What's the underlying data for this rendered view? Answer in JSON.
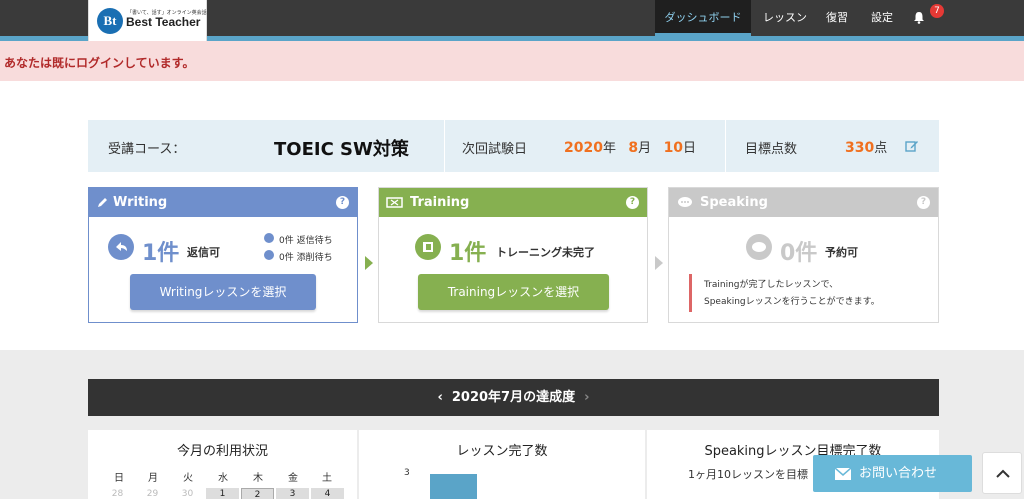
{
  "header": {
    "logo_tagline": "「書いて、話す」オンライン英会話",
    "logo_name": "Best Teacher",
    "logo_mark": "Bt",
    "nav": [
      "ダッシュボード",
      "レッスン",
      "復習",
      "設定"
    ],
    "notification_count": "7"
  },
  "alert": "あなたは既にログインしています。",
  "course": {
    "label": "受講コース：",
    "name": "TOEIC SW対策",
    "exam_label": "次回試験日",
    "exam_year": "2020",
    "year_unit": "年",
    "exam_month": "8",
    "month_unit": "月",
    "exam_day": "10",
    "day_unit": "日",
    "target_label": "目標点数",
    "target_score": "330",
    "score_unit": "点"
  },
  "writing": {
    "title": "Writing",
    "count": "1件",
    "status": "返信可",
    "waiting_reply": "0件 返信待ち",
    "waiting_correction": "0件 添削待ち",
    "button": "Writingレッスンを選択"
  },
  "training": {
    "title": "Training",
    "count": "1件",
    "status": "トレーニング未完了",
    "button": "Trainingレッスンを選択"
  },
  "speaking": {
    "title": "Speaking",
    "count": "0件",
    "status": "予約可",
    "note_line1": "Trainingが完了したレッスンで、",
    "note_line2": "Speakingレッスンを行うことができます。"
  },
  "achievement": {
    "title": "2020年7月の達成度",
    "usage_title": "今月の利用状況",
    "weekdays": [
      "日",
      "月",
      "火",
      "水",
      "木",
      "金",
      "土"
    ],
    "days": [
      "28",
      "29",
      "30",
      "1",
      "2",
      "3",
      "4"
    ],
    "lessons_title": "レッスン完了数",
    "lessons_axis_value": "3",
    "speaking_target_title": "Speakingレッスン目標完了数",
    "speaking_target_sub": "1ヶ月10レッスンを目標"
  },
  "contact_button": "お問い合わせ",
  "colors": {
    "writing": "#6f8fcc",
    "training": "#86b050",
    "speaking": "#c9c9c9",
    "accent": "#f0701f"
  }
}
